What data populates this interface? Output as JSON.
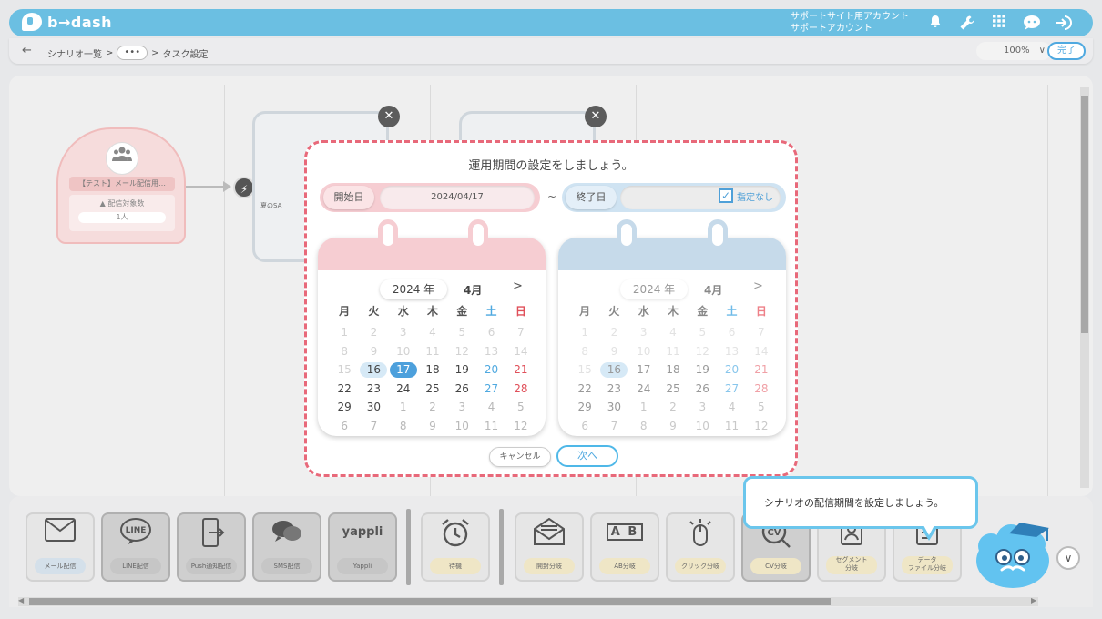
{
  "header": {
    "logo_text": "b→dash",
    "account_line1": "サポートサイト用アカウント",
    "account_line2": "サポートアカウント",
    "icons": [
      "bell-icon",
      "wrench-icon",
      "grid-icon",
      "chat-icon",
      "logout-icon"
    ]
  },
  "subbar": {
    "crumb_root": "シナリオ一覧",
    "crumb_sep": ">",
    "crumb_dots": "•••",
    "crumb_current": "タスク設定",
    "zoom": "100%",
    "done": "完了"
  },
  "canvas": {
    "start_node": {
      "title": "【テスト】メール配信用…",
      "target_label": "配信対象数",
      "target_count": "1人"
    },
    "mail_node_label": "夏のSA"
  },
  "modal": {
    "title": "運用期間の設定をしましょう。",
    "start_tag": "開始日",
    "start_value": "2024/04/17",
    "tilde": "~",
    "end_tag": "終了日",
    "no_end_label": "指定なし",
    "no_end_checked": true,
    "cancel": "キャンセル",
    "next": "次へ",
    "weekdays": [
      "月",
      "火",
      "水",
      "木",
      "金",
      "土",
      "日"
    ],
    "start_calendar": {
      "year": "2024 年",
      "month": "4月",
      "next": ">",
      "weeks": [
        [
          "1",
          "2",
          "3",
          "4",
          "5",
          "6",
          "7"
        ],
        [
          "8",
          "9",
          "10",
          "11",
          "12",
          "13",
          "14"
        ],
        [
          "15",
          "16",
          "17",
          "18",
          "19",
          "20",
          "21"
        ],
        [
          "22",
          "23",
          "24",
          "25",
          "26",
          "27",
          "28"
        ],
        [
          "29",
          "30",
          "1",
          "2",
          "3",
          "4",
          "5"
        ],
        [
          "6",
          "7",
          "8",
          "9",
          "10",
          "11",
          "12"
        ]
      ]
    },
    "end_calendar": {
      "year": "2024 年",
      "month": "4月",
      "next": ">",
      "weeks": [
        [
          "1",
          "2",
          "3",
          "4",
          "5",
          "6",
          "7"
        ],
        [
          "8",
          "9",
          "10",
          "11",
          "12",
          "13",
          "14"
        ],
        [
          "15",
          "16",
          "17",
          "18",
          "19",
          "20",
          "21"
        ],
        [
          "22",
          "23",
          "24",
          "25",
          "26",
          "27",
          "28"
        ],
        [
          "29",
          "30",
          "1",
          "2",
          "3",
          "4",
          "5"
        ],
        [
          "6",
          "7",
          "8",
          "9",
          "10",
          "11",
          "12"
        ]
      ]
    }
  },
  "palette": {
    "tools": [
      {
        "label": "メール配信",
        "icon": "mail-icon"
      },
      {
        "label": "LINE配信",
        "icon": "line-icon"
      },
      {
        "label": "Push通知配信",
        "icon": "push-icon"
      },
      {
        "label": "SMS配信",
        "icon": "sms-icon"
      },
      {
        "label": "Yappli",
        "icon": "yappli-icon"
      },
      {
        "label": "待機",
        "icon": "alarm-icon"
      },
      {
        "label": "開封分岐",
        "icon": "open-mail-icon"
      },
      {
        "label": "AB分岐",
        "icon": "ab-icon"
      },
      {
        "label": "クリック分岐",
        "icon": "mouse-icon"
      },
      {
        "label": "CV分岐",
        "icon": "cv-icon"
      },
      {
        "label": "セグメント\n分岐",
        "icon": "segment-icon"
      },
      {
        "label": "データ\nファイル分岐",
        "icon": "file-icon"
      }
    ],
    "yappli_text": "yappli",
    "line_text": "LINE",
    "ab_text": "A B",
    "cv_text": "CV"
  },
  "tooltip": {
    "text": "シナリオの配信期間を設定しましょう。"
  }
}
